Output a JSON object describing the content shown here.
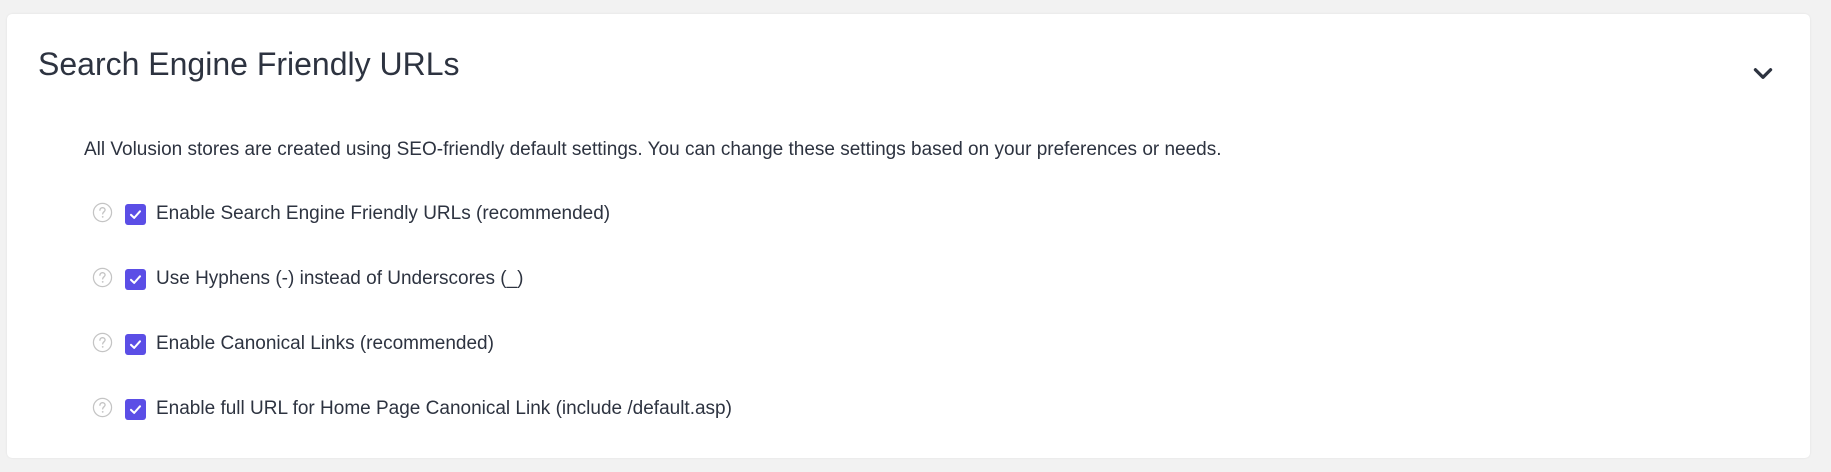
{
  "section": {
    "title": "Search Engine Friendly URLs",
    "collapse_icon": "chevron-down-icon",
    "intro": "All Volusion stores are created using SEO-friendly default settings. You can change these settings based on your preferences or needs."
  },
  "colors": {
    "checkbox_accent": "#5b4ee6",
    "text": "#2d3340",
    "help_icon": "#c4c4c4",
    "background": "#f2f2f2",
    "panel": "#ffffff"
  },
  "options": [
    {
      "label": "Enable Search Engine Friendly URLs (recommended)",
      "checked": true,
      "help_icon": "question-circle-icon"
    },
    {
      "label": "Use Hyphens (-) instead of Underscores (_)",
      "checked": true,
      "help_icon": "question-circle-icon"
    },
    {
      "label": "Enable Canonical Links (recommended)",
      "checked": true,
      "help_icon": "question-circle-icon"
    },
    {
      "label": "Enable full URL for Home Page Canonical Link (include /default.asp)",
      "checked": true,
      "help_icon": "question-circle-icon"
    }
  ]
}
